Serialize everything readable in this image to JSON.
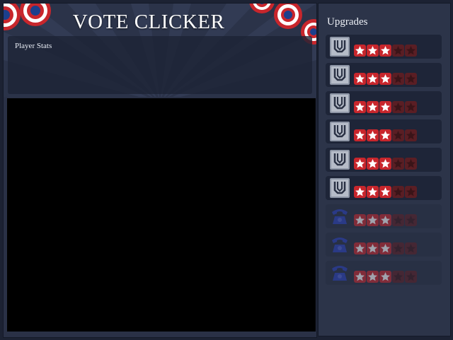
{
  "header": {
    "title": "VOTE CLICKER"
  },
  "stats": {
    "label": "Player Stats"
  },
  "upgrades": {
    "title": "Upgrades",
    "max_stars": 5,
    "items": [
      {
        "icon": "ballot-box-icon",
        "stars": 3,
        "locked": false
      },
      {
        "icon": "ballot-box-icon",
        "stars": 3,
        "locked": false
      },
      {
        "icon": "ballot-box-icon",
        "stars": 3,
        "locked": false
      },
      {
        "icon": "ballot-box-icon",
        "stars": 3,
        "locked": false
      },
      {
        "icon": "ballot-box-icon",
        "stars": 3,
        "locked": false
      },
      {
        "icon": "ballot-box-icon",
        "stars": 3,
        "locked": false
      },
      {
        "icon": "telephone-icon",
        "stars": 3,
        "locked": true
      },
      {
        "icon": "telephone-icon",
        "stars": 3,
        "locked": true
      },
      {
        "icon": "telephone-icon",
        "stars": 3,
        "locked": true
      }
    ]
  },
  "colors": {
    "star_active": "#c8262c",
    "star_inactive": "#5a1e24",
    "bunting_red": "#c8262c",
    "bunting_blue": "#1c3f8c"
  }
}
